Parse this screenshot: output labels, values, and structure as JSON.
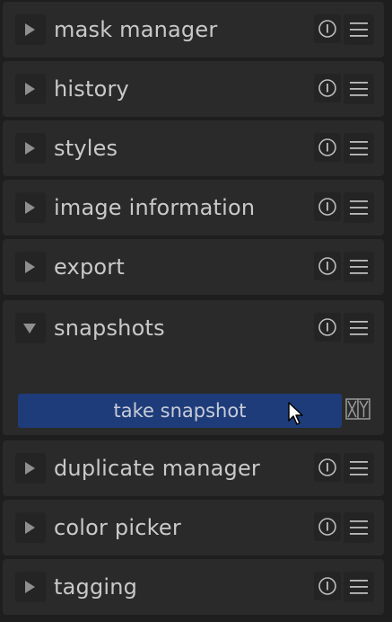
{
  "modules": [
    {
      "label": "mask manager",
      "expanded": false
    },
    {
      "label": "history",
      "expanded": false
    },
    {
      "label": "styles",
      "expanded": false
    },
    {
      "label": "image information",
      "expanded": false
    },
    {
      "label": "export",
      "expanded": false
    },
    {
      "label": "snapshots",
      "expanded": true
    },
    {
      "label": "duplicate manager",
      "expanded": false
    },
    {
      "label": "color picker",
      "expanded": false
    },
    {
      "label": "tagging",
      "expanded": false
    }
  ],
  "snapshots": {
    "take_snapshot_label": "take snapshot"
  },
  "icons": {
    "collapsed": "triangle-right-icon",
    "expanded": "triangle-down-icon",
    "info": "info-icon",
    "menu": "hamburger-menu-icon",
    "compare": "compare-snapshot-icon",
    "cursor": "mouse-pointer-icon"
  },
  "colors": {
    "background": "#1e1e1e",
    "panel": "#2a2a2a",
    "text": "#c9c9c9",
    "accent_button": "#1e3c7a"
  }
}
